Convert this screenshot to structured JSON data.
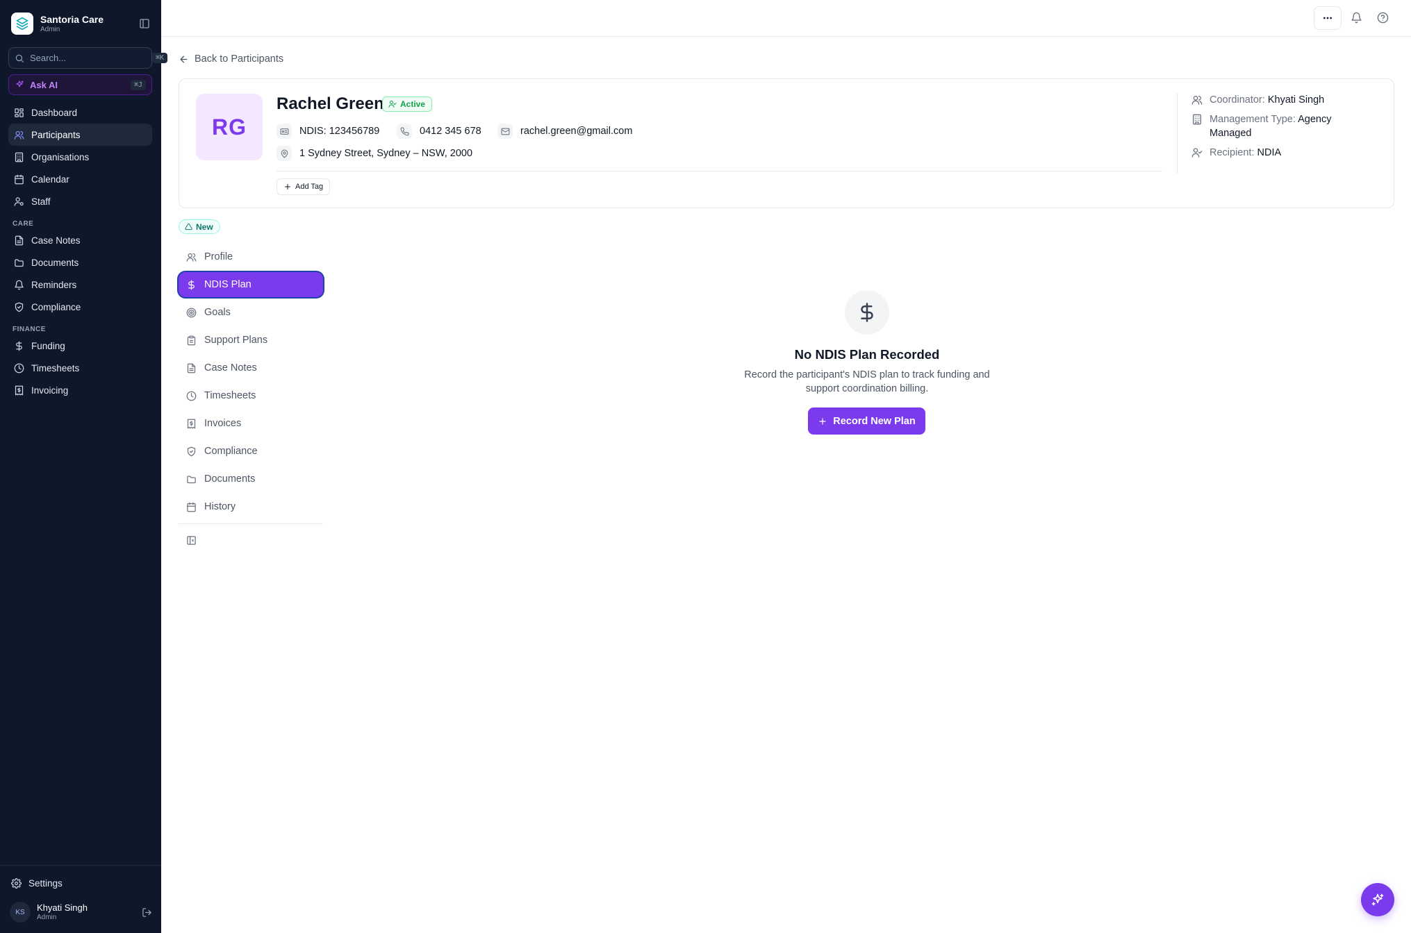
{
  "brand": {
    "name": "Santoria Care",
    "role": "Admin",
    "logo_icon": "layers-logo-icon"
  },
  "search": {
    "placeholder": "Search...",
    "shortcut": "⌘K"
  },
  "ask_ai": {
    "label": "Ask AI",
    "shortcut": "⌘J"
  },
  "nav": {
    "main": [
      {
        "label": "Dashboard",
        "icon": "grid-icon"
      },
      {
        "label": "Participants",
        "icon": "users-icon",
        "active": true
      },
      {
        "label": "Organisations",
        "icon": "building-icon"
      },
      {
        "label": "Calendar",
        "icon": "calendar-icon"
      },
      {
        "label": "Staff",
        "icon": "user-cog-icon"
      }
    ],
    "care_title": "CARE",
    "care": [
      {
        "label": "Case Notes",
        "icon": "file-text-icon"
      },
      {
        "label": "Documents",
        "icon": "folder-icon"
      },
      {
        "label": "Reminders",
        "icon": "bell-icon"
      },
      {
        "label": "Compliance",
        "icon": "shield-check-icon"
      }
    ],
    "finance_title": "FINANCE",
    "finance": [
      {
        "label": "Funding",
        "icon": "dollar-icon"
      },
      {
        "label": "Timesheets",
        "icon": "clock-icon"
      },
      {
        "label": "Invoicing",
        "icon": "receipt-icon"
      }
    ]
  },
  "settings": {
    "label": "Settings"
  },
  "user": {
    "initials": "KS",
    "name": "Khyati Singh",
    "role": "Admin"
  },
  "back_link": "Back to Participants",
  "participant": {
    "initials": "RG",
    "name": "Rachel Green",
    "status": "Active",
    "ndis": "NDIS: 123456789",
    "phone": "0412 345 678",
    "email": "rachel.green@gmail.com",
    "address": "1 Sydney Street, Sydney – NSW, 2000",
    "add_tag": "Add Tag",
    "coordinator_label": "Coordinator:",
    "coordinator": "Khyati Singh",
    "management_label": "Management Type:",
    "management": "Agency Managed",
    "recipient_label": "Recipient:",
    "recipient": "NDIA",
    "badge": "New"
  },
  "tabs": [
    {
      "label": "Profile",
      "icon": "user-icon"
    },
    {
      "label": "NDIS Plan",
      "icon": "dollar-icon",
      "active": true
    },
    {
      "label": "Goals",
      "icon": "target-icon"
    },
    {
      "label": "Support Plans",
      "icon": "clipboard-icon"
    },
    {
      "label": "Case Notes",
      "icon": "file-text-icon"
    },
    {
      "label": "Timesheets",
      "icon": "clock-icon"
    },
    {
      "label": "Invoices",
      "icon": "receipt-icon"
    },
    {
      "label": "Compliance",
      "icon": "shield-check-icon"
    },
    {
      "label": "Documents",
      "icon": "folder-icon"
    },
    {
      "label": "History",
      "icon": "calendar-icon"
    }
  ],
  "empty_state": {
    "title": "No NDIS Plan Recorded",
    "description_line1": "Record the participant's NDIS plan to track funding and",
    "description_line2": "support coordination billing.",
    "button": "Record New Plan"
  },
  "colors": {
    "accent": "#7c3aed",
    "sidebar": "#0f172a",
    "active_status": "#16a34a"
  }
}
